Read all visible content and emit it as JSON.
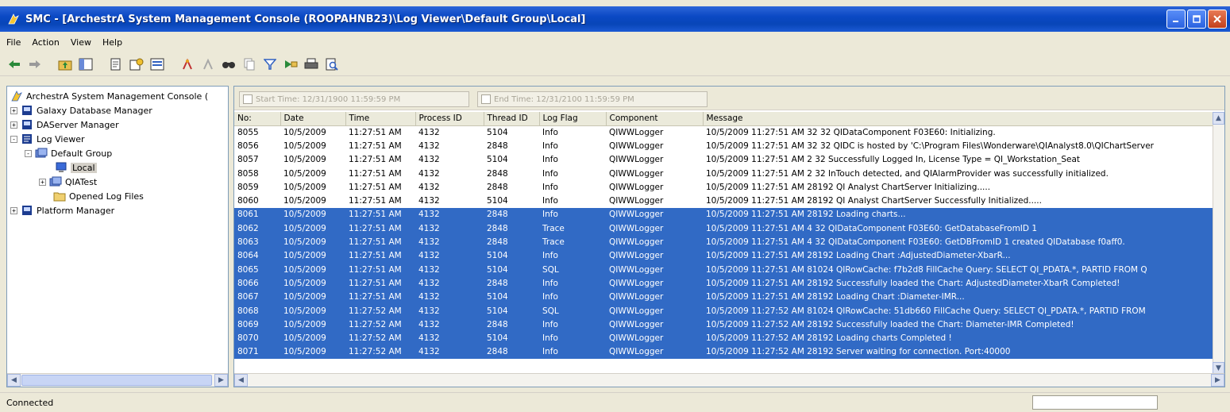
{
  "window": {
    "title": "SMC - [ArchestrA System Management Console (ROOPAHNB23)\\Log Viewer\\Default Group\\Local]"
  },
  "menu": [
    "File",
    "Action",
    "View",
    "Help"
  ],
  "toolbar_icons": [
    "back-arrow-icon",
    "forward-arrow-icon",
    "up-folder-icon",
    "show-tree-icon",
    "export-icon",
    "properties-icon",
    "console-tree-icon",
    "mark-icon",
    "unmark-icon",
    "find-icon",
    "copy-icon",
    "filter-icon",
    "go-to-icon",
    "print-icon",
    "print-preview-icon"
  ],
  "tree": {
    "root": "ArchestrA System Management Console (",
    "items": [
      {
        "label": "Galaxy Database Manager",
        "expander": "+"
      },
      {
        "label": "DAServer Manager",
        "expander": "+"
      },
      {
        "label": "Log Viewer",
        "expander": "-"
      },
      {
        "label": "Default Group",
        "expander": "-"
      },
      {
        "label": "Local",
        "expander": ""
      },
      {
        "label": "QIATest",
        "expander": "+"
      },
      {
        "label": "Opened Log Files",
        "expander": ""
      },
      {
        "label": "Platform Manager",
        "expander": "+"
      }
    ]
  },
  "filters": {
    "start_time": "Start Time: 12/31/1900 11:59:59 PM",
    "end_time": "End Time: 12/31/2100 11:59:59 PM"
  },
  "columns": [
    "No:",
    "Date",
    "Time",
    "Process ID",
    "Thread ID",
    "Log Flag",
    "Component",
    "Message"
  ],
  "rows": [
    {
      "no": "8055",
      "date": "10/5/2009",
      "time": "11:27:51 AM",
      "pid": "4132",
      "tid": "5104",
      "flag": "Info",
      "comp": "QIWWLogger",
      "msg": "10/5/2009 11:27:51 AM  32  32 QIDataComponent F03E60: Initializing.",
      "selected": false
    },
    {
      "no": "8056",
      "date": "10/5/2009",
      "time": "11:27:51 AM",
      "pid": "4132",
      "tid": "2848",
      "flag": "Info",
      "comp": "QIWWLogger",
      "msg": "10/5/2009 11:27:51 AM  32  32 QIDC is hosted by 'C:\\Program Files\\Wonderware\\QIAnalyst8.0\\QIChartServer",
      "selected": false
    },
    {
      "no": "8057",
      "date": "10/5/2009",
      "time": "11:27:51 AM",
      "pid": "4132",
      "tid": "5104",
      "flag": "Info",
      "comp": "QIWWLogger",
      "msg": "10/5/2009 11:27:51 AM  2  32 Successfully Logged In, License Type = QI_Workstation_Seat",
      "selected": false
    },
    {
      "no": "8058",
      "date": "10/5/2009",
      "time": "11:27:51 AM",
      "pid": "4132",
      "tid": "2848",
      "flag": "Info",
      "comp": "QIWWLogger",
      "msg": "10/5/2009 11:27:51 AM  2  32 InTouch detected, and QIAlarmProvider was successfully initialized.",
      "selected": false
    },
    {
      "no": "8059",
      "date": "10/5/2009",
      "time": "11:27:51 AM",
      "pid": "4132",
      "tid": "2848",
      "flag": "Info",
      "comp": "QIWWLogger",
      "msg": "10/5/2009 11:27:51 AM  28192 QI Analyst ChartServer Initializing.....",
      "selected": false
    },
    {
      "no": "8060",
      "date": "10/5/2009",
      "time": "11:27:51 AM",
      "pid": "4132",
      "tid": "5104",
      "flag": "Info",
      "comp": "QIWWLogger",
      "msg": "10/5/2009 11:27:51 AM  28192 QI Analyst ChartServer Successfully Initialized.....",
      "selected": false
    },
    {
      "no": "8061",
      "date": "10/5/2009",
      "time": "11:27:51 AM",
      "pid": "4132",
      "tid": "2848",
      "flag": "Info",
      "comp": "QIWWLogger",
      "msg": "10/5/2009 11:27:51 AM  28192 Loading charts...",
      "selected": true
    },
    {
      "no": "8062",
      "date": "10/5/2009",
      "time": "11:27:51 AM",
      "pid": "4132",
      "tid": "2848",
      "flag": "Trace",
      "comp": "QIWWLogger",
      "msg": "10/5/2009 11:27:51 AM  4  32 QIDataComponent F03E60: GetDatabaseFromID 1",
      "selected": true
    },
    {
      "no": "8063",
      "date": "10/5/2009",
      "time": "11:27:51 AM",
      "pid": "4132",
      "tid": "2848",
      "flag": "Trace",
      "comp": "QIWWLogger",
      "msg": "10/5/2009 11:27:51 AM  4  32 QIDataComponent F03E60: GetDBFromID 1 created QIDatabase f0aff0.",
      "selected": true
    },
    {
      "no": "8064",
      "date": "10/5/2009",
      "time": "11:27:51 AM",
      "pid": "4132",
      "tid": "5104",
      "flag": "Info",
      "comp": "QIWWLogger",
      "msg": "10/5/2009 11:27:51 AM  28192 Loading Chart :AdjustedDiameter-XbarR...",
      "selected": true
    },
    {
      "no": "8065",
      "date": "10/5/2009",
      "time": "11:27:51 AM",
      "pid": "4132",
      "tid": "5104",
      "flag": "SQL",
      "comp": "QIWWLogger",
      "msg": "10/5/2009 11:27:51 AM  81024 QIRowCache: f7b2d8 FillCache Query: SELECT QI_PDATA.*, PARTID FROM Q",
      "selected": true
    },
    {
      "no": "8066",
      "date": "10/5/2009",
      "time": "11:27:51 AM",
      "pid": "4132",
      "tid": "2848",
      "flag": "Info",
      "comp": "QIWWLogger",
      "msg": "10/5/2009 11:27:51 AM  28192 Successfully loaded the Chart: AdjustedDiameter-XbarR Completed!",
      "selected": true
    },
    {
      "no": "8067",
      "date": "10/5/2009",
      "time": "11:27:51 AM",
      "pid": "4132",
      "tid": "5104",
      "flag": "Info",
      "comp": "QIWWLogger",
      "msg": "10/5/2009 11:27:51 AM  28192 Loading Chart :Diameter-IMR...",
      "selected": true
    },
    {
      "no": "8068",
      "date": "10/5/2009",
      "time": "11:27:52 AM",
      "pid": "4132",
      "tid": "5104",
      "flag": "SQL",
      "comp": "QIWWLogger",
      "msg": "10/5/2009 11:27:52 AM  81024 QIRowCache: 51db660 FillCache Query: SELECT QI_PDATA.*, PARTID FROM",
      "selected": true
    },
    {
      "no": "8069",
      "date": "10/5/2009",
      "time": "11:27:52 AM",
      "pid": "4132",
      "tid": "2848",
      "flag": "Info",
      "comp": "QIWWLogger",
      "msg": "10/5/2009 11:27:52 AM  28192 Successfully loaded the Chart: Diameter-IMR Completed!",
      "selected": true
    },
    {
      "no": "8070",
      "date": "10/5/2009",
      "time": "11:27:52 AM",
      "pid": "4132",
      "tid": "5104",
      "flag": "Info",
      "comp": "QIWWLogger",
      "msg": "10/5/2009 11:27:52 AM  28192 Loading charts Completed !",
      "selected": true
    },
    {
      "no": "8071",
      "date": "10/5/2009",
      "time": "11:27:52 AM",
      "pid": "4132",
      "tid": "2848",
      "flag": "Info",
      "comp": "QIWWLogger",
      "msg": "10/5/2009 11:27:52 AM  28192 Server waiting for connection.  Port:40000",
      "selected": true
    }
  ],
  "status": {
    "text": "Connected"
  },
  "colors": {
    "selection": "#316ac5",
    "titlebar": "#0a48c4"
  }
}
